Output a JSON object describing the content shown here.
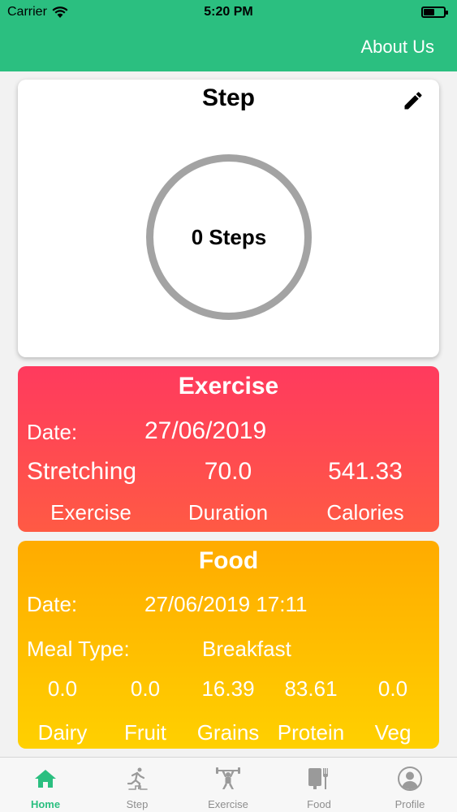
{
  "status_bar": {
    "carrier": "Carrier",
    "time": "5:20 PM"
  },
  "header": {
    "about_label": "About Us",
    "color": "#2bbf80"
  },
  "step_card": {
    "title": "Step",
    "count_text": "0 Steps",
    "edit_icon": "pencil-icon"
  },
  "exercise_card": {
    "title": "Exercise",
    "date_label": "Date:",
    "date_value": "27/06/2019",
    "exercise_value": "Stretching",
    "duration_value": "70.0",
    "calories_value": "541.33",
    "exercise_label": "Exercise",
    "duration_label": "Duration",
    "calories_label": "Calories",
    "color": "#ff4553"
  },
  "food_card": {
    "title": "Food",
    "date_label": "Date:",
    "date_value": "27/06/2019 17:11",
    "meal_type_label": "Meal Type:",
    "meal_type_value": "Breakfast",
    "values": [
      "0.0",
      "0.0",
      "16.39",
      "83.61",
      "0.0"
    ],
    "labels": [
      "Dairy",
      "Fruit",
      "Grains",
      "Protein",
      "Veg"
    ],
    "color": "#ffbb00"
  },
  "tabs": [
    {
      "label": "Home",
      "icon": "home-icon",
      "active": true
    },
    {
      "label": "Step",
      "icon": "runner-icon",
      "active": false
    },
    {
      "label": "Exercise",
      "icon": "weightlifter-icon",
      "active": false
    },
    {
      "label": "Food",
      "icon": "food-icon",
      "active": false
    },
    {
      "label": "Profile",
      "icon": "profile-icon",
      "active": false
    }
  ]
}
